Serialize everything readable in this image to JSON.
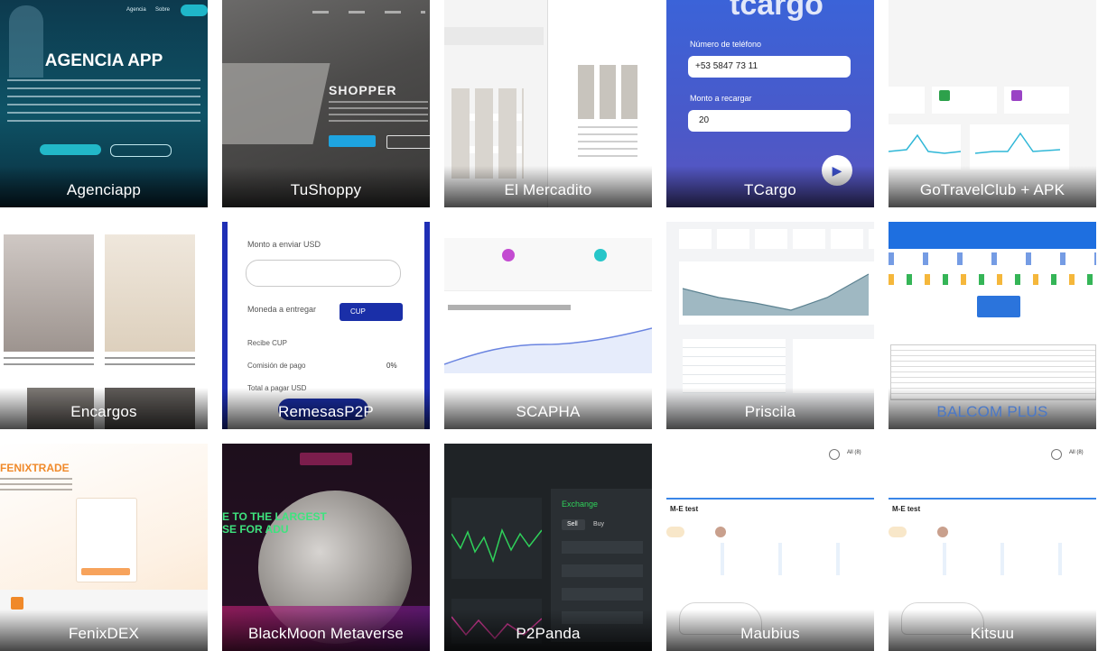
{
  "tiles": [
    {
      "title": "Agenciapp",
      "hero": "AGENCIA APP",
      "nav": [
        "Agencia",
        "Sobre"
      ]
    },
    {
      "title": "TuShoppy",
      "hero": "SHOPPER"
    },
    {
      "title": "El Mercadito"
    },
    {
      "title": "TCargo",
      "phone_label": "Número de teléfono",
      "phone_value": "+53 5847 73 11",
      "amount_label": "Monto a recargar",
      "amount_value": "20"
    },
    {
      "title": "GoTravelClub + APK"
    },
    {
      "title": "Encargos"
    },
    {
      "title": "RemesasP2P",
      "amount_label": "Monto a enviar USD",
      "deliver_label": "Moneda a entregar",
      "currency": "CUP",
      "rate_label": "Recibe CUP",
      "fee_label": "Comisión de pago",
      "fee_value": "0%",
      "total_label": "Total a pagar USD"
    },
    {
      "title": "SCAPHA"
    },
    {
      "title": "Priscila"
    },
    {
      "title": "BALCOM PLUS"
    },
    {
      "title": "FenixDEX",
      "hero": "FENIXTRADE"
    },
    {
      "title": "BlackMoon Metaverse",
      "hero_line1": "E TO THE LARGEST",
      "hero_line2": "SE FOR ADU"
    },
    {
      "title": "P2Panda",
      "exchange_label": "Exchange",
      "sell": "Sell",
      "buy": "Buy"
    },
    {
      "title": "Maubius",
      "record": "M-E test",
      "filter": "All (8)"
    },
    {
      "title": "Kitsuu",
      "record": "M-E test",
      "filter": "All (8)"
    }
  ],
  "colors": {
    "caption": "#ffffff",
    "accent": "#3a63d6"
  }
}
